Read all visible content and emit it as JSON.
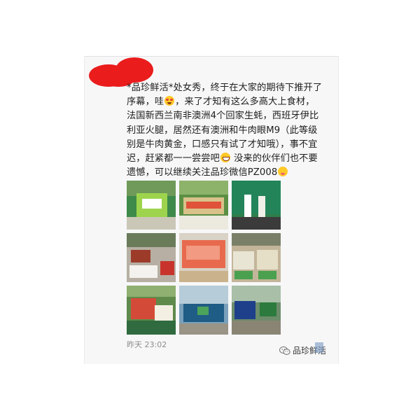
{
  "post": {
    "text_lines": [
      "*品珍鲜活*处女秀，终于在大家的期待下推开了",
      "序幕，哇",
      "，来了才知有这么多高大上食材，",
      "法国新西兰南非澳洲4个回家生蚝，西班牙伊比",
      "利亚火腿，居然还有澳洲和牛肉眼M9（此等级",
      "别是牛肉黄金，口感只有试了才知哦），事不宜",
      "迟，赶紧都一一尝尝吧",
      " 没来的伙伴们也不要",
      "遗憾，可以继续关注品珍微信PZ008"
    ],
    "emoji_icons": [
      "smiling-face-with-heart-eyes-icon",
      "grinning-face-icon",
      "face-savoring-food-icon"
    ],
    "photo_count": 9,
    "time": "昨天 23:02",
    "source_name": "品珍鲜活"
  },
  "colors": {
    "card_background": "#f7f7f8",
    "redaction": "#ea1c1c",
    "timestamp": "#8c8c8c"
  }
}
